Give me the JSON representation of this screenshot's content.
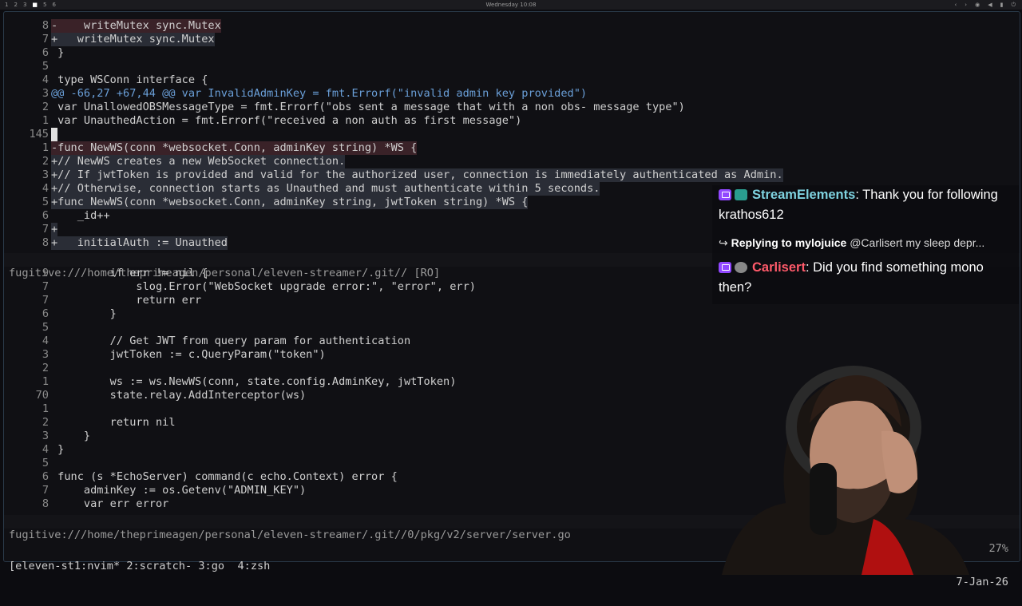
{
  "topbar": {
    "workspaces": [
      "1",
      "2",
      "3",
      "4",
      "5",
      "6"
    ],
    "active_workspace": "4",
    "clock": "Wednesday 10:08",
    "tray_icons": [
      "arrow-left-icon",
      "arrow-right-icon",
      "wifi-icon",
      "volume-icon",
      "battery-icon",
      "power-icon"
    ]
  },
  "upper_pane": {
    "lines": [
      {
        "ln": "8",
        "kind": "del",
        "text": "-    writeMutex sync.Mutex"
      },
      {
        "ln": "7",
        "kind": "add",
        "text": "+   writeMutex sync.Mutex"
      },
      {
        "ln": "6",
        "kind": "ctx",
        "text": " }"
      },
      {
        "ln": "5",
        "kind": "ctx",
        "text": ""
      },
      {
        "ln": "4",
        "kind": "ctx",
        "text": " type WSConn interface {"
      },
      {
        "ln": "3",
        "kind": "hunk",
        "text": "@@ -66,27 +67,44 @@ var InvalidAdminKey = fmt.Errorf(\"invalid admin key provided\")"
      },
      {
        "ln": "2",
        "kind": "ctx",
        "text": " var UnallowedOBSMessageType = fmt.Errorf(\"obs sent a message that with a non obs- message type\")"
      },
      {
        "ln": "1",
        "kind": "ctx",
        "text": " var UnauthedAction = fmt.Errorf(\"received a non auth as first message\")"
      },
      {
        "ln": "145",
        "kind": "cursor",
        "text": " "
      },
      {
        "ln": "1",
        "kind": "del",
        "text": "-func NewWS(conn *websocket.Conn, adminKey string) *WS {"
      },
      {
        "ln": "2",
        "kind": "add",
        "text": "+// NewWS creates a new WebSocket connection."
      },
      {
        "ln": "3",
        "kind": "add",
        "text": "+// If jwtToken is provided and valid for the authorized user, connection is immediately authenticated as Admin."
      },
      {
        "ln": "4",
        "kind": "add",
        "text": "+// Otherwise, connection starts as Unauthed and must authenticate within 5 seconds."
      },
      {
        "ln": "5",
        "kind": "add",
        "text": "+func NewWS(conn *websocket.Conn, adminKey string, jwtToken string) *WS {"
      },
      {
        "ln": "6",
        "kind": "ctx",
        "text": "    _id++"
      },
      {
        "ln": "7",
        "kind": "add",
        "text": "+"
      },
      {
        "ln": "8",
        "kind": "add",
        "text": "+   initialAuth := Unauthed"
      }
    ],
    "status_path": "fugitive:///home/theprimeagen/personal/eleven-streamer/.git// [RO]"
  },
  "lower_pane": {
    "lines": [
      {
        "ln": "9",
        "text": "         if err != nil {"
      },
      {
        "ln": "7",
        "text": "             slog.Error(\"WebSocket upgrade error:\", \"error\", err)"
      },
      {
        "ln": "7",
        "text": "             return err"
      },
      {
        "ln": "6",
        "text": "         }"
      },
      {
        "ln": "5",
        "text": ""
      },
      {
        "ln": "4",
        "text": "         // Get JWT from query param for authentication"
      },
      {
        "ln": "3",
        "text": "         jwtToken := c.QueryParam(\"token\")"
      },
      {
        "ln": "2",
        "text": ""
      },
      {
        "ln": "1",
        "text": "         ws := ws.NewWS(conn, state.config.AdminKey, jwtToken)"
      },
      {
        "ln": "70",
        "text": "         state.relay.AddInterceptor(ws)"
      },
      {
        "ln": "1",
        "text": ""
      },
      {
        "ln": "2",
        "text": "         return nil"
      },
      {
        "ln": "3",
        "text": "     }"
      },
      {
        "ln": "4",
        "text": " }"
      },
      {
        "ln": "5",
        "text": ""
      },
      {
        "ln": "6",
        "text": " func (s *EchoServer) command(c echo.Context) error {"
      },
      {
        "ln": "7",
        "text": "     adminKey := os.Getenv(\"ADMIN_KEY\")"
      },
      {
        "ln": "8",
        "text": "     var err error"
      }
    ],
    "status_path": "fugitive:///home/theprimeagen/personal/eleven-streamer/.git//0/pkg/v2/server/server.go",
    "status_percent": "27%"
  },
  "tmux": {
    "left": "[eleven-st1:nvim* 2:scratch- 3:go  4:zsh",
    "right": "7-Jan-26"
  },
  "chat": {
    "msg1_user": "StreamElements",
    "msg1_text": ": Thank you for following krathos612",
    "reply_label": "Replying to mylojuice",
    "reply_text": " @Carlisert my sleep depr...",
    "msg2_user": "Carlisert",
    "msg2_text": ": Did you find something mono then?"
  },
  "colors": {
    "del_bg": "#3a2228",
    "add_bg": "#2a2d36",
    "keyword": "#d08bd0",
    "function": "#8ab0e8",
    "streamelements": "#7fd3e0",
    "carlisert": "#ff5a6a",
    "twitch": "#9147ff"
  }
}
